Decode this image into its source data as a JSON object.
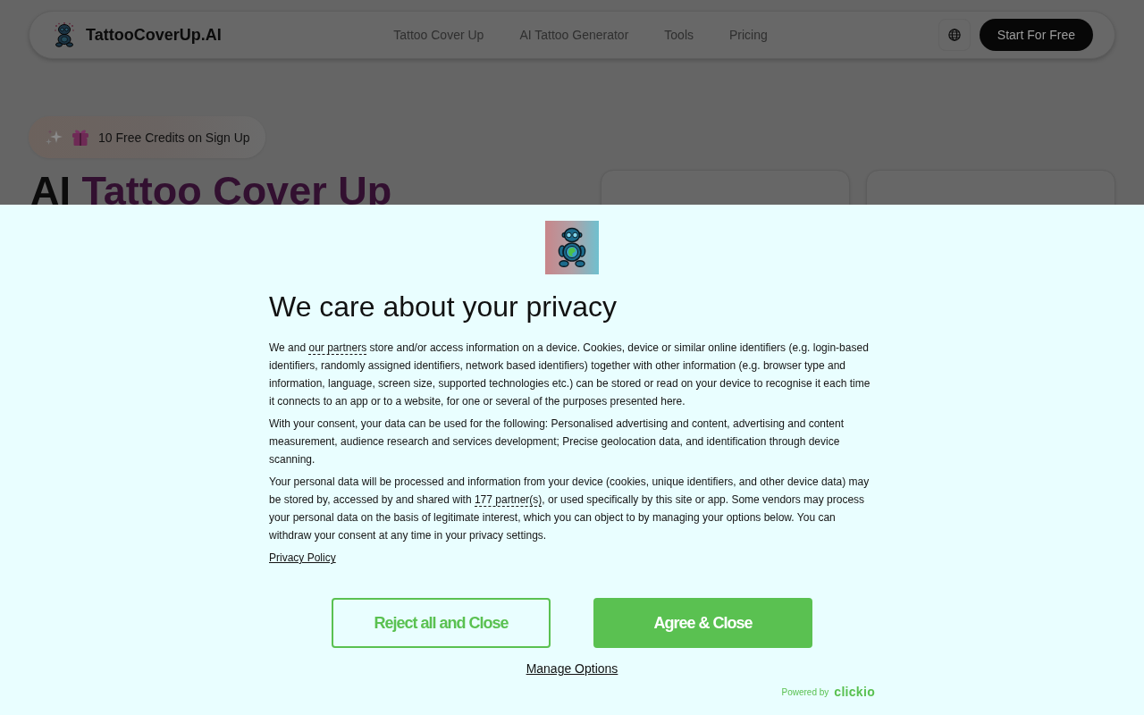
{
  "header": {
    "brand": "TattooCoverUp.AI",
    "nav": [
      {
        "label": "Tattoo Cover Up"
      },
      {
        "label": "AI Tattoo Generator"
      },
      {
        "label": "Tools"
      },
      {
        "label": "Pricing"
      }
    ],
    "cta": "Start For Free"
  },
  "hero": {
    "badge": "10 Free Credits on Sign Up",
    "title_lead": "AI",
    "title_highlight": "Tattoo Cover Up"
  },
  "consent": {
    "title": "We care about your privacy",
    "paragraphs": [
      {
        "segments": [
          {
            "kind": "text",
            "text": "We and "
          },
          {
            "kind": "link",
            "text": "our partners"
          },
          {
            "kind": "text",
            "text": " store and/or access information on a device. Cookies, device or similar online identifiers (e.g. login-based identifiers, randomly assigned identifiers, network based identifiers) together with other information (e.g. browser type and information, language, screen size, supported technologies etc.) can be stored or read on your device to recognise it each time it connects to an app or to a website, for one or several of the purposes presented here."
          }
        ]
      },
      {
        "segments": [
          {
            "kind": "text",
            "text": "With your consent, your data can be used for the following: Personalised advertising and content, advertising and content measurement, audience research and services development; Precise geolocation data, and identification through device scanning."
          }
        ]
      },
      {
        "segments": [
          {
            "kind": "text",
            "text": "Your personal data will be processed and information from your device (cookies, unique identifiers, and other device data) may be stored by, accessed by and shared with "
          },
          {
            "kind": "link",
            "text": "177 partner(s)"
          },
          {
            "kind": "text",
            "text": ", or used specifically by this site or app. Some vendors may process your personal data on the basis of legitimate interest, which you can object to by managing your options below. You can withdraw your consent at any time in your privacy settings."
          }
        ]
      }
    ],
    "privacy_link": "Privacy Policy",
    "buttons": [
      {
        "label": "Reject all and Close",
        "kind": "outline"
      },
      {
        "label": "Agree & Close",
        "kind": "filled"
      }
    ],
    "manage_link": "Manage Options",
    "powered_by": "Powered by",
    "vendor_logo": "clickio"
  }
}
